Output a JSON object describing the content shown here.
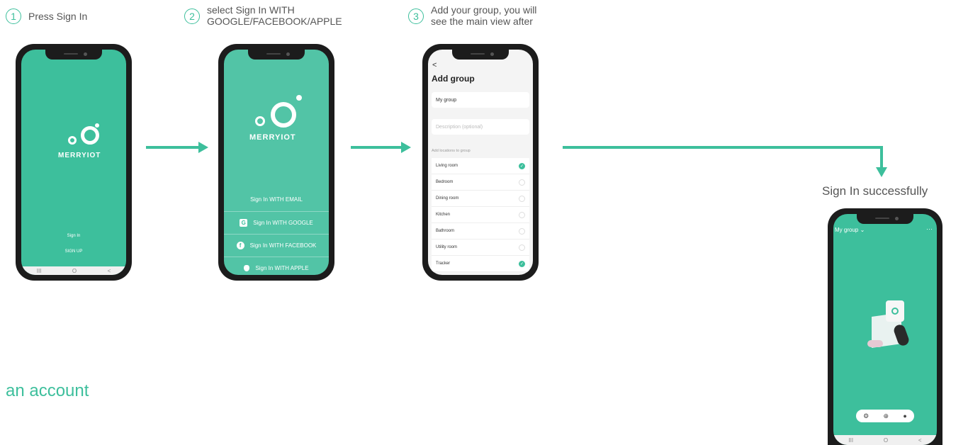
{
  "steps": [
    {
      "num": "1",
      "line1": "Press Sign In",
      "line2": ""
    },
    {
      "num": "2",
      "line1": "select Sign In WITH",
      "line2": "GOOGLE/FACEBOOK/APPLE"
    },
    {
      "num": "3",
      "line1": "Add your group, you will",
      "line2": "see the main view after"
    }
  ],
  "success_label": "Sign In successfully",
  "account_text": "an account",
  "colors": {
    "accent": "#3dbf9c",
    "phone": "#1c1c1c"
  },
  "phone1": {
    "brand": "MERRYIOT",
    "sign_in": "Sign In",
    "sign_up": "SIGN UP",
    "nav": [
      "III",
      "O",
      "<"
    ]
  },
  "phone2": {
    "brand": "MERRYIOT",
    "options": [
      {
        "icon": "",
        "label": "Sign In WITH EMAIL"
      },
      {
        "icon": "G",
        "label": "Sign In WITH GOOGLE"
      },
      {
        "icon": "f",
        "label": "Sign In WITH FACEBOOK"
      },
      {
        "icon": "",
        "label": "Sign In WITH APPLE"
      }
    ]
  },
  "phone3": {
    "back": "<",
    "title": "Add group",
    "name_value": "My group",
    "description_placeholder": "Description (optional)",
    "section_label": "Add locations to group",
    "locations": [
      {
        "name": "Living room",
        "checked": true
      },
      {
        "name": "Bedroom",
        "checked": false
      },
      {
        "name": "Dining room",
        "checked": false
      },
      {
        "name": "Kitchen",
        "checked": false
      },
      {
        "name": "Bathroom",
        "checked": false
      },
      {
        "name": "Utility room",
        "checked": false
      },
      {
        "name": "Tracker",
        "checked": true
      }
    ]
  },
  "phone4": {
    "group_title": "My group ⌄",
    "more": "···",
    "toolbar_icons": [
      "gear-icon",
      "add-icon",
      "bell-icon"
    ],
    "nav": [
      "III",
      "O",
      "<"
    ]
  }
}
